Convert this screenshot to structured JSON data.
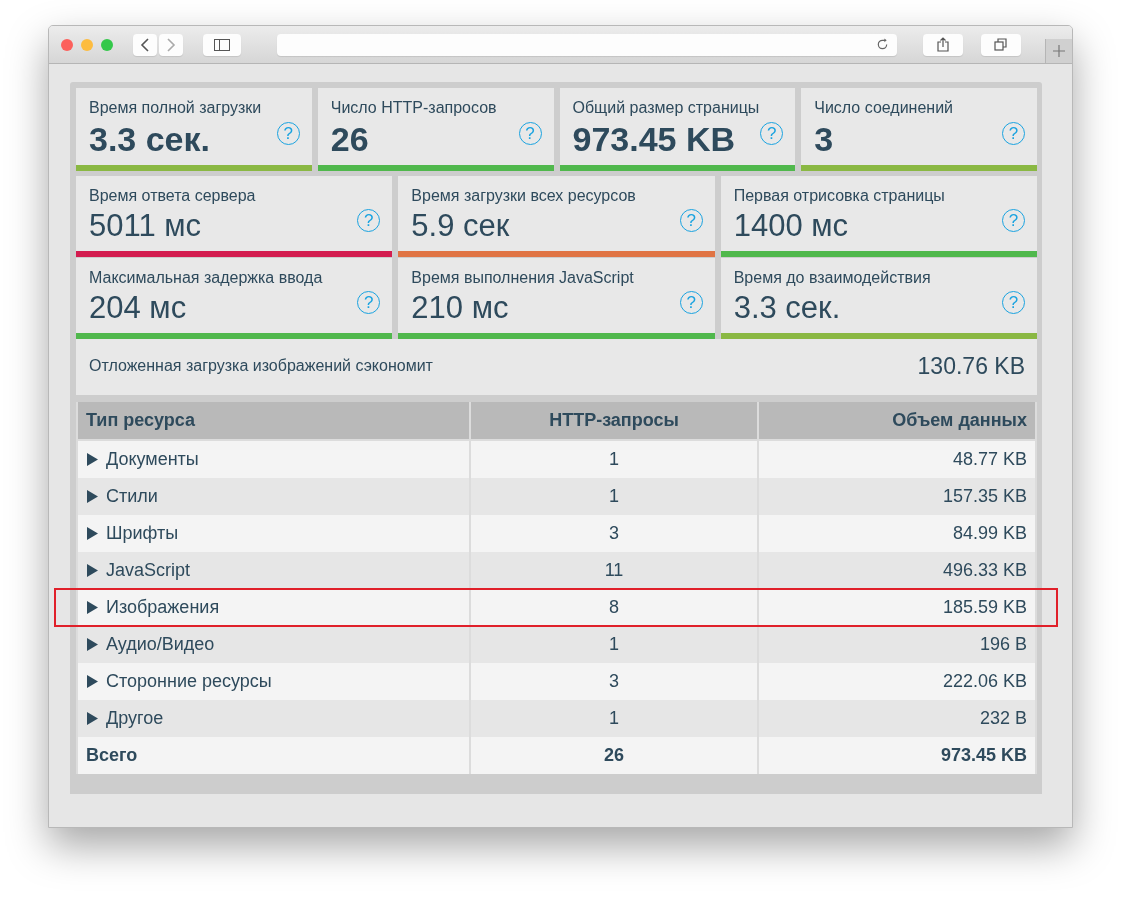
{
  "summary_metrics": [
    {
      "label": "Время полной загрузки",
      "value": "3.3 сек.",
      "color": "#8ab843",
      "help": "?"
    },
    {
      "label": "Число HTTP-запросов",
      "value": "26",
      "color": "#50b84c",
      "help": "?"
    },
    {
      "label": "Общий размер страницы",
      "value": "973.45 KB",
      "color": "#50b84c",
      "help": "?"
    },
    {
      "label": "Число соединений",
      "value": "3",
      "color": "#8ab843",
      "help": "?"
    }
  ],
  "timing_metrics": [
    {
      "label": "Время ответа сервера",
      "value": "5011 мс",
      "color": "#d31c4f",
      "help": "?"
    },
    {
      "label": "Время загрузки всех ресурсов",
      "value": "5.9 сек",
      "color": "#e07444",
      "help": "?"
    },
    {
      "label": "Первая отрисовка страницы",
      "value": "1400 мс",
      "color": "#50b84c",
      "help": "?"
    },
    {
      "label": "Максимальная задержка ввода",
      "value": "204 мс",
      "color": "#50b84c",
      "help": "?"
    },
    {
      "label": "Время выполнения JavaScript",
      "value": "210 мс",
      "color": "#50b84c",
      "help": "?"
    },
    {
      "label": "Время до взаимодействия",
      "value": "3.3 сек.",
      "color": "#8ab843",
      "help": "?"
    }
  ],
  "lazy_load": {
    "label": "Отложенная загрузка изображений сэкономит",
    "value": "130.76 KB"
  },
  "table": {
    "columns": [
      "Тип ресурса",
      "HTTP-запросы",
      "Объем данных"
    ],
    "rows": [
      {
        "type": "Документы",
        "requests": "1",
        "size": "48.77 KB",
        "expanded": false,
        "highlighted": false
      },
      {
        "type": "Стили",
        "requests": "1",
        "size": "157.35 KB",
        "expanded": false,
        "highlighted": false
      },
      {
        "type": "Шрифты",
        "requests": "3",
        "size": "84.99 KB",
        "expanded": false,
        "highlighted": false
      },
      {
        "type": "JavaScript",
        "requests": "11",
        "size": "496.33 KB",
        "expanded": false,
        "highlighted": false
      },
      {
        "type": "Изображения",
        "requests": "8",
        "size": "185.59 KB",
        "expanded": false,
        "highlighted": true
      },
      {
        "type": "Аудио/Видео",
        "requests": "1",
        "size": "196 B",
        "expanded": false,
        "highlighted": false
      },
      {
        "type": "Сторонние ресурсы",
        "requests": "3",
        "size": "222.06 KB",
        "expanded": false,
        "highlighted": false
      },
      {
        "type": "Другое",
        "requests": "1",
        "size": "232 B",
        "expanded": false,
        "highlighted": false
      }
    ],
    "total": {
      "type": "Всего",
      "requests": "26",
      "size": "973.45 KB"
    }
  }
}
